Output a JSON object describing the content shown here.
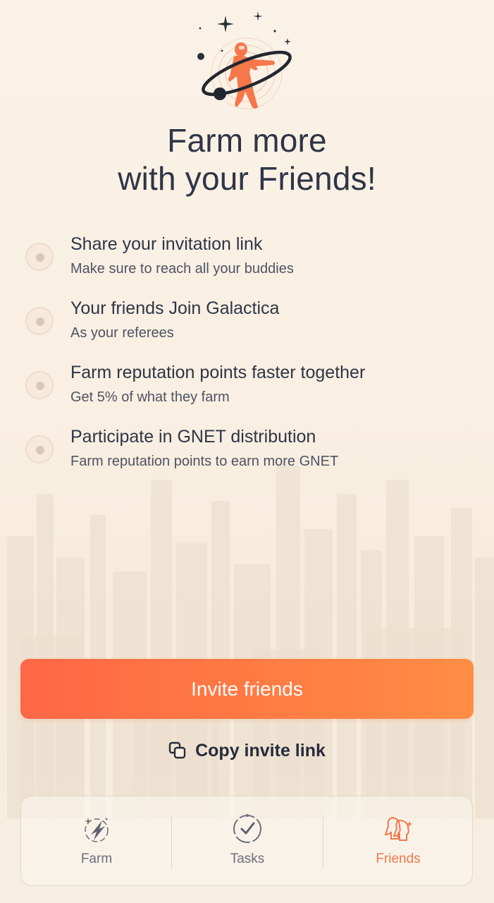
{
  "headline": {
    "line1": "Farm more",
    "line2": "with your Friends!"
  },
  "steps": [
    {
      "title": "Share your invitation link",
      "subtitle": "Make sure to reach all your buddies"
    },
    {
      "title": "Your friends Join Galactica",
      "subtitle": "As your referees"
    },
    {
      "title": "Farm reputation points faster together",
      "subtitle": "Get 5% of what they farm"
    },
    {
      "title": "Participate in GNET distribution",
      "subtitle": "Farm reputation points to earn more GNET"
    }
  ],
  "invite_button": {
    "label": "Invite friends"
  },
  "copy_link": {
    "label": "Copy invite link",
    "icon": "copy-icon"
  },
  "tabs": [
    {
      "label": "Farm",
      "icon": "farm-icon",
      "active": false
    },
    {
      "label": "Tasks",
      "icon": "tasks-icon",
      "active": false
    },
    {
      "label": "Friends",
      "icon": "friends-icon",
      "active": true
    }
  ],
  "colors": {
    "accent": "#ff7547",
    "button_gradient_start": "#ff6746",
    "button_gradient_end": "#ff8d44",
    "active_tab": "#f2784e",
    "text": "#2e3547"
  }
}
